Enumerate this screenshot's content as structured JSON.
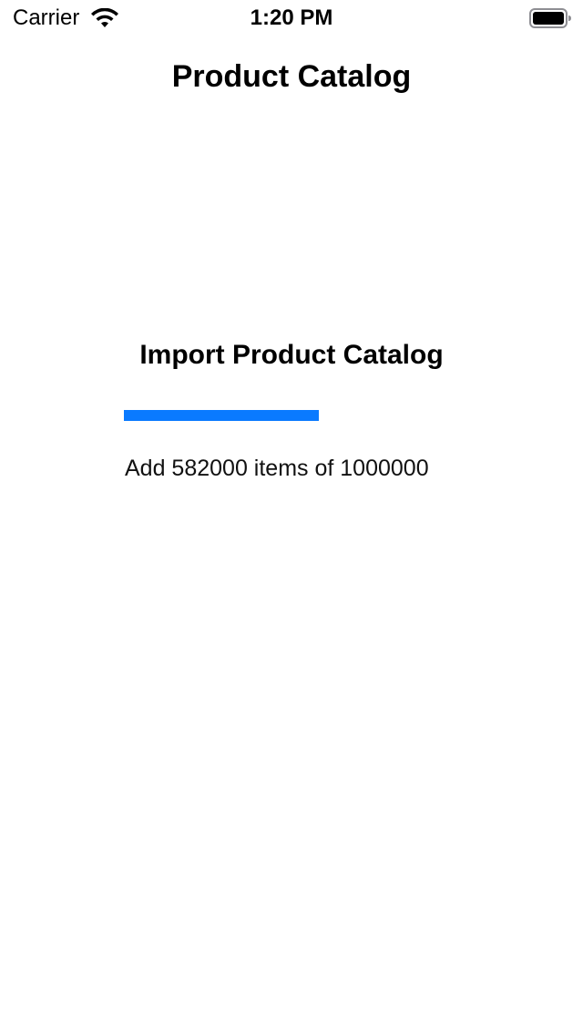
{
  "status_bar": {
    "carrier": "Carrier",
    "time": "1:20 PM",
    "icons": [
      "wifi-icon",
      "battery-icon"
    ]
  },
  "nav": {
    "title": "Product Catalog"
  },
  "import": {
    "title": "Import Product Catalog",
    "progress_fraction": 0.582,
    "progress_color": "#0a7aff",
    "status_text": "Add 582000 items of 1000000"
  }
}
